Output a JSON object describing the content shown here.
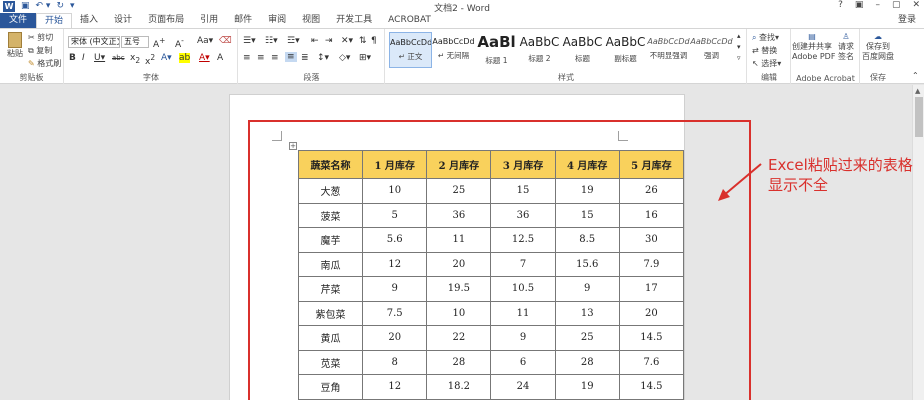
{
  "titlebar": {
    "app_logo": "W",
    "title": "文档2 - Word",
    "controls": [
      "?",
      "▣",
      "–",
      "▢",
      "✕"
    ]
  },
  "tabs": {
    "items": [
      {
        "label": "文件",
        "style": "file"
      },
      {
        "label": "开始",
        "style": "active"
      },
      {
        "label": "插入"
      },
      {
        "label": "设计"
      },
      {
        "label": "页面布局"
      },
      {
        "label": "引用"
      },
      {
        "label": "邮件"
      },
      {
        "label": "审阅"
      },
      {
        "label": "视图"
      },
      {
        "label": "开发工具"
      },
      {
        "label": "ACROBAT"
      }
    ],
    "login": "登录"
  },
  "ribbon": {
    "clipboard": {
      "paste": "粘贴",
      "cut": "剪切",
      "copy": "复制",
      "format_painter": "格式刷",
      "label": "剪贴板"
    },
    "font": {
      "font_name": "宋体 (中文正文",
      "font_size": "五号",
      "label": "字体"
    },
    "paragraph": {
      "label": "段落"
    },
    "styles": {
      "items": [
        {
          "sample": "AaBbCcDd",
          "name": "↵ 正文"
        },
        {
          "sample": "AaBbCcDd",
          "name": "↵ 无间隔"
        },
        {
          "sample": "AaBl",
          "name": "标题 1"
        },
        {
          "sample": "AaBbC",
          "name": "标题 2"
        },
        {
          "sample": "AaBbC",
          "name": "标题"
        },
        {
          "sample": "AaBbC",
          "name": "副标题"
        },
        {
          "sample": "AaBbCcDd",
          "name": "不明显强调"
        },
        {
          "sample": "AaBbCcDd",
          "name": "强调"
        }
      ],
      "label": "样式"
    },
    "editing": {
      "find": "查找",
      "replace": "替换",
      "select": "选择",
      "label": "编辑"
    },
    "acrobat": {
      "create_share": "创建并共享",
      "adobe_pdf": "Adobe PDF",
      "request": "请求",
      "sign": "签名",
      "label": "Adobe Acrobat"
    },
    "save": {
      "save_to": "保存到",
      "baidu": "百度网盘",
      "label": "保存"
    }
  },
  "table": {
    "headers": [
      "蔬菜名称",
      "1 月库存",
      "2 月库存",
      "3 月库存",
      "4 月库存",
      "5 月库存"
    ],
    "rows": [
      [
        "大葱",
        "10",
        "25",
        "15",
        "19",
        "26"
      ],
      [
        "菠菜",
        "5",
        "36",
        "36",
        "15",
        "16"
      ],
      [
        "魔芋",
        "5.6",
        "11",
        "12.5",
        "8.5",
        "30"
      ],
      [
        "南瓜",
        "12",
        "20",
        "7",
        "15.6",
        "7.9"
      ],
      [
        "芹菜",
        "9",
        "19.5",
        "10.5",
        "9",
        "17"
      ],
      [
        "紫包菜",
        "7.5",
        "10",
        "11",
        "13",
        "20"
      ],
      [
        "黄瓜",
        "20",
        "22",
        "9",
        "25",
        "14.5"
      ],
      [
        "苋菜",
        "8",
        "28",
        "6",
        "28",
        "7.6"
      ],
      [
        "豆角",
        "12",
        "18.2",
        "24",
        "19",
        "14.5"
      ]
    ]
  },
  "annotation": {
    "text_line1": "Excel粘贴过来的表格",
    "text_line2": "显示不全",
    "color": "#d9302c"
  }
}
